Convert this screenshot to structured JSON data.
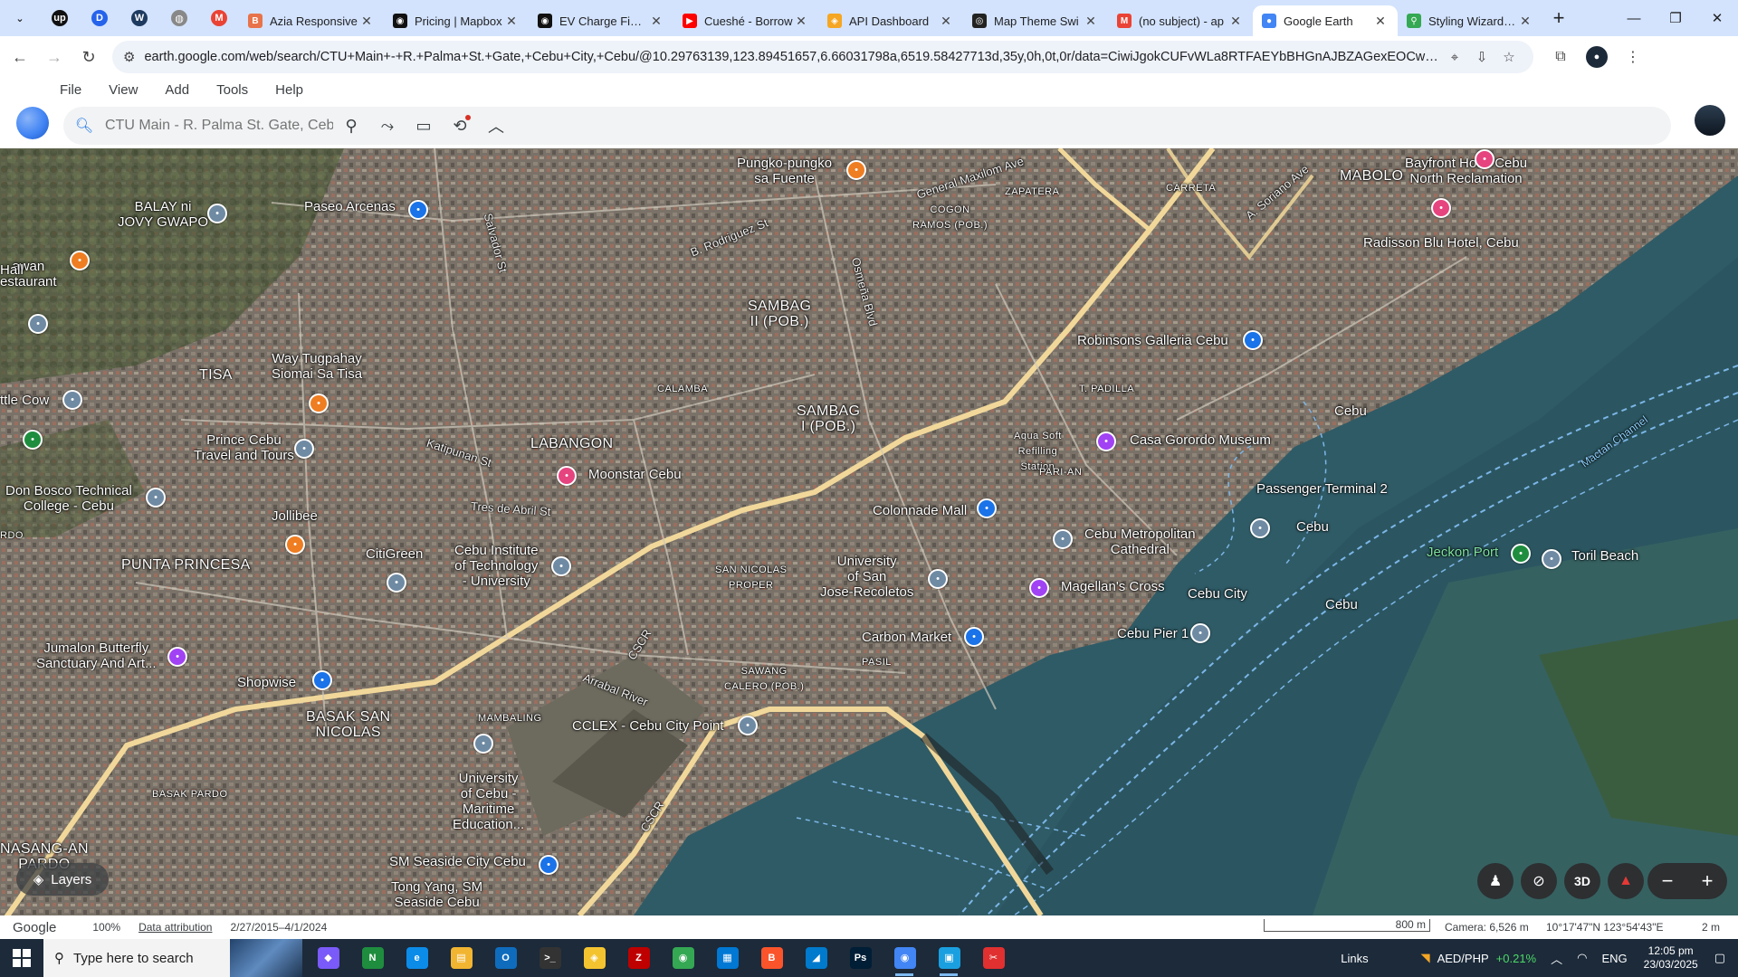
{
  "browser": {
    "pinned": [
      {
        "icon": "chevron-down-icon",
        "glyph": "⌄"
      },
      {
        "icon": "upwork-icon",
        "glyph": "up",
        "color": "#111111"
      },
      {
        "icon": "dashboard-icon",
        "glyph": "D",
        "color": "#2563eb"
      },
      {
        "icon": "wordpress-icon",
        "glyph": "W",
        "color": "#1e3a5f"
      },
      {
        "icon": "globe-icon",
        "glyph": "◍",
        "color": "#888888"
      },
      {
        "icon": "gmail-icon",
        "glyph": "M",
        "color": "#ea4335"
      }
    ],
    "tabs": [
      {
        "title": "Azia Responsive",
        "icon": "B",
        "color": "#e8734a"
      },
      {
        "title": "Pricing | Mapbox",
        "icon": "◉",
        "color": "#111111"
      },
      {
        "title": "EV Charge Finder",
        "icon": "◉",
        "color": "#111111"
      },
      {
        "title": "Cueshé - Borrow",
        "icon": "▶",
        "color": "#ff0000"
      },
      {
        "title": "API Dashboard",
        "icon": "◈",
        "color": "#f5a623"
      },
      {
        "title": "Map Theme Swi",
        "icon": "◎",
        "color": "#222222"
      },
      {
        "title": "(no subject) - ap",
        "icon": "M",
        "color": "#ea4335"
      },
      {
        "title": "Google Earth",
        "icon": "●",
        "color": "#4285f4",
        "active": true
      },
      {
        "title": "Styling Wizard: G",
        "icon": "⚲",
        "color": "#34a853"
      }
    ],
    "url": "earth.google.com/web/search/CTU+Main+-+R.+Palma+St.+Gate,+Cebu+City,+Cebu/@10.29763139,123.89451657,6.66031798a,6519.58427713d,35y,0h,0t,0r/data=CiwiJgokCUFvWLa8RTFAEYbBHGnAJBZAGexEOCwyWGBAIc4wS6L_DV5AQgIIAT..."
  },
  "earth": {
    "menu": [
      "File",
      "View",
      "Add",
      "Tools",
      "Help"
    ],
    "search_placeholder": "CTU Main - R. Palma St. Gate, Cebu",
    "tools": [
      "pin-icon",
      "path-icon",
      "ruler-icon",
      "history-icon",
      "collapse-icon"
    ],
    "layers_label": "Layers",
    "controls": {
      "pegman": "pegman-icon",
      "tilt": "tilt-icon",
      "view3d": "3D",
      "compass": "compass-icon",
      "zoom_out": "−",
      "zoom_in": "+"
    }
  },
  "map": {
    "labels": [
      {
        "text": "Pungko-pungko\nsa Fuente"
      },
      {
        "text": "MABOLO",
        "big": true
      },
      {
        "text": "Bayfront Hotel Cebu\nNorth Reclamation"
      },
      {
        "text": "BALAY ni\nJOVY GWAPO"
      },
      {
        "text": "Paseo Arcenas"
      },
      {
        "text": "General Maxilom Ave",
        "road": true
      },
      {
        "text": "ZAPATERA",
        "sm": true
      },
      {
        "text": "COGON\nRAMOS (POB.)",
        "sm": true
      },
      {
        "text": "CARRETA",
        "sm": true
      },
      {
        "text": "Radisson Blu Hotel, Cebu"
      },
      {
        "text": "awan\nestaurant"
      },
      {
        "text": "B. Rodriguez St",
        "road": true
      },
      {
        "text": "SAMBAG\nII (POB.)",
        "big": true
      },
      {
        "text": "A. Soriano Ave",
        "road": true
      },
      {
        "text": "Robinsons Galleria Cebu"
      },
      {
        "text": "Way Tugpahay\nSiomai Sa Tisa"
      },
      {
        "text": "TISA",
        "big": true
      },
      {
        "text": "CALAMBA",
        "sm": true
      },
      {
        "text": "SAMBAG\nI (POB.)",
        "big": true
      },
      {
        "text": "T. PADILLA",
        "sm": true
      },
      {
        "text": "ttle Cow"
      },
      {
        "text": "Prince Cebu\nTravel and Tours"
      },
      {
        "text": "Katipunan St",
        "road": true
      },
      {
        "text": "LABANGON",
        "big": true
      },
      {
        "text": "Moonstar Cebu"
      },
      {
        "text": "Aqua Soft\nRefilling\nStation",
        "sm": true
      },
      {
        "text": "Casa Gorordo Museum"
      },
      {
        "text": "PARI-AN",
        "sm": true
      },
      {
        "text": "Passenger Terminal 2",
        "sea": false
      },
      {
        "text": "Don Bosco Technical\nCollege - Cebu"
      },
      {
        "text": "Tres de Abril St",
        "road": true
      },
      {
        "text": "Colonnade Mall"
      },
      {
        "text": "Jollibee"
      },
      {
        "text": "Cebu"
      },
      {
        "text": "CitiGreen"
      },
      {
        "text": "Cebu Institute\nof Technology\n- University"
      },
      {
        "text": "University\nof San\nJose-Recoletos"
      },
      {
        "text": "Cebu Metropolitan\nCathedral"
      },
      {
        "text": "Jeckon Port",
        "green": true
      },
      {
        "text": "Toril Beach"
      },
      {
        "text": "PUNTA PRINCESA",
        "big": true
      },
      {
        "text": "SAN NICOLAS\nPROPER",
        "sm": true
      },
      {
        "text": "Magellan's Cross"
      },
      {
        "text": "Cebu City"
      },
      {
        "text": "Carbon Market"
      },
      {
        "text": "Cebu Pier 1"
      },
      {
        "text": "Jumalon Butterfly\nSanctuary And Art..."
      },
      {
        "text": "PASIL",
        "sm": true
      },
      {
        "text": "SAWANG\nCALERO (POB.)",
        "sm": true
      },
      {
        "text": "Shopwise"
      },
      {
        "text": "Arrabal River",
        "road": true
      },
      {
        "text": "BASAK SAN\nNICOLAS",
        "big": true
      },
      {
        "text": "MAMBALING",
        "sm": true
      },
      {
        "text": "CCLEX - Cebu City Point"
      },
      {
        "text": "BASAK PARDO",
        "sm": true
      },
      {
        "text": "University\nof Cebu -\nMaritime\nEducation..."
      },
      {
        "text": "CSCR",
        "road": true
      },
      {
        "text": "CSCR",
        "road": true
      },
      {
        "text": "NASANG-AN\nPARDO",
        "big": true
      },
      {
        "text": "SM Seaside City Cebu"
      },
      {
        "text": "Tong Yang, SM\nSeaside Cebu"
      },
      {
        "text": "Mactan Channel",
        "sea": true
      },
      {
        "text": "Cebu"
      },
      {
        "text": "Osmeña Blvd",
        "road": true
      },
      {
        "text": "Salvador St",
        "road": true
      },
      {
        "text": "Hall"
      },
      {
        "text": "RDO",
        "sm": true
      },
      {
        "text": "Cebu"
      }
    ]
  },
  "status": {
    "brand": "Google",
    "zoom": "100%",
    "attribution": "Data attribution",
    "imagery_dates": "2/27/2015–4/1/2024",
    "scale_label": "800 m",
    "camera": "Camera: 6,526 m",
    "coords": "10°17'47\"N 123°54'43\"E",
    "elevation": "2 m"
  },
  "taskbar": {
    "search_placeholder": "Type here to search",
    "apps": [
      {
        "name": "copilot-icon",
        "glyph": "◆",
        "color": "#7a5af8"
      },
      {
        "name": "notepad-icon",
        "glyph": "N",
        "color": "#1e8e3e"
      },
      {
        "name": "edge-icon",
        "glyph": "e",
        "color": "#0c8ce9"
      },
      {
        "name": "file-explorer-icon",
        "glyph": "▤",
        "color": "#f2b531"
      },
      {
        "name": "outlook-icon",
        "glyph": "O",
        "color": "#0f6cbd"
      },
      {
        "name": "terminal-icon",
        "glyph": ">_",
        "color": "#333333"
      },
      {
        "name": "git-icon",
        "glyph": "◈",
        "color": "#f4c430"
      },
      {
        "name": "filezilla-icon",
        "glyph": "Z",
        "color": "#bf0000"
      },
      {
        "name": "chrome-icon",
        "glyph": "◉",
        "color": "#34a853"
      },
      {
        "name": "store-icon",
        "glyph": "▦",
        "color": "#0078d4"
      },
      {
        "name": "brave-icon",
        "glyph": "B",
        "color": "#fb542b"
      },
      {
        "name": "vscode-icon",
        "glyph": "◢",
        "color": "#007acc"
      },
      {
        "name": "photoshop-icon",
        "glyph": "Ps",
        "color": "#001e36"
      },
      {
        "name": "chrome-profile-icon",
        "glyph": "◉",
        "color": "#4285f4",
        "open": true
      },
      {
        "name": "app-icon",
        "glyph": "▣",
        "color": "#1aa0e0",
        "open": true
      },
      {
        "name": "pdf-icon",
        "glyph": "✂",
        "color": "#e03030"
      }
    ],
    "links": "Links",
    "ticker": "AED/PHP",
    "ticker_change": "+0.21%",
    "lang": "ENG",
    "time": "12:05 pm",
    "date": "23/03/2025"
  }
}
